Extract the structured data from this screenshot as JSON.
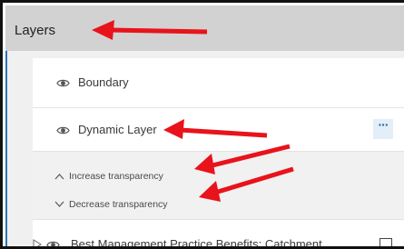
{
  "panel": {
    "title": "Layers"
  },
  "layers": [
    {
      "label": "Boundary",
      "visibility_icon": "eye-icon"
    },
    {
      "label": "Dynamic Layer",
      "visibility_icon": "eye-icon",
      "menu_label": "···"
    },
    {
      "label": "Best Management Practice Benefits: Catchment",
      "visibility_icon": "eye-icon",
      "expand_icon": "triangle-right-icon",
      "checked": true
    }
  ],
  "layer_options": {
    "increase": "Increase transparency",
    "decrease": "Decrease transparency"
  },
  "colors": {
    "header_bg": "#d2d2d2",
    "accent": "#1f64b3",
    "annotation_arrow": "#e8131b"
  }
}
